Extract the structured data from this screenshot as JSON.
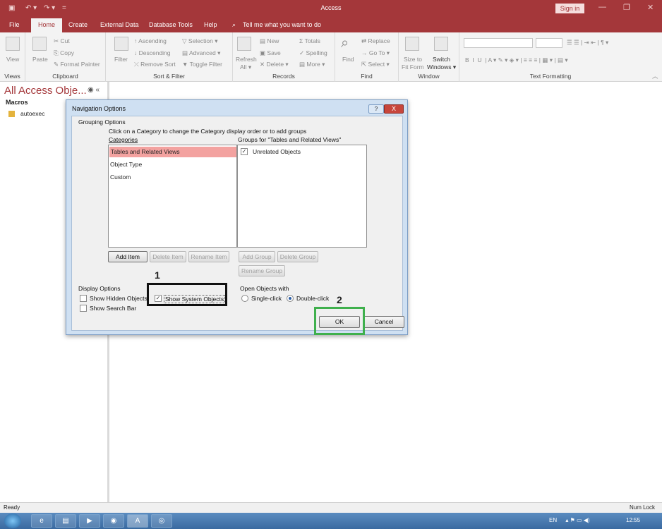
{
  "window": {
    "title": "Access",
    "sign_in": "Sign in"
  },
  "tabs": [
    "File",
    "Home",
    "Create",
    "External Data",
    "Database Tools",
    "Help"
  ],
  "tell_me": "Tell me what you want to do",
  "ribbon": {
    "views": {
      "view": "View",
      "group": "Views"
    },
    "clipboard": {
      "paste": "Paste",
      "cut": "Cut",
      "copy": "Copy",
      "format_painter": "Format Painter",
      "group": "Clipboard"
    },
    "sort_filter": {
      "filter": "Filter",
      "ascending": "Ascending",
      "descending": "Descending",
      "remove_sort": "Remove Sort",
      "selection": "Selection",
      "advanced": "Advanced",
      "toggle_filter": "Toggle Filter",
      "group": "Sort & Filter"
    },
    "records": {
      "refresh": "Refresh",
      "refresh_all": "All",
      "new": "New",
      "save": "Save",
      "delete": "Delete",
      "totals": "Totals",
      "spelling": "Spelling",
      "more": "More",
      "group": "Records"
    },
    "find": {
      "find": "Find",
      "replace": "Replace",
      "goto": "Go To",
      "select": "Select",
      "group": "Find"
    },
    "window": {
      "size_to_fit": "Size to",
      "size_to_fit2": "Fit Form",
      "switch": "Switch",
      "switch2": "Windows",
      "group": "Window"
    },
    "text_formatting": {
      "group": "Text Formatting"
    }
  },
  "nav_pane": {
    "title": "All Access Obje...",
    "section": "Macros",
    "items": [
      "autoexec"
    ]
  },
  "status": {
    "left": "Ready",
    "right": "Num Lock"
  },
  "taskbar": {
    "lang": "EN",
    "clock": "12:55"
  },
  "dialog": {
    "title": "Navigation Options",
    "help": "?",
    "close": "X",
    "grouping_options": "Grouping Options",
    "instruction": "Click on a Category to change the Category display order or to add groups",
    "categories_label": "Categories",
    "groups_label": "Groups for \"Tables and Related Views\"",
    "categories": [
      "Tables and Related Views",
      "Object Type",
      "Custom"
    ],
    "groups": [
      {
        "label": "Unrelated Objects",
        "checked": true
      }
    ],
    "buttons": {
      "add_item": "Add Item",
      "delete_item": "Delete Item",
      "rename_item": "Rename Item",
      "add_group": "Add Group",
      "delete_group": "Delete Group",
      "rename_group": "Rename Group",
      "ok": "OK",
      "cancel": "Cancel"
    },
    "display_options": {
      "label": "Display Options",
      "show_hidden": {
        "label": "Show Hidden Objects",
        "checked": false
      },
      "show_system": {
        "label": "Show System Objects",
        "checked": true
      },
      "show_search": {
        "label": "Show Search Bar",
        "checked": false
      }
    },
    "open_objects": {
      "label": "Open Objects with",
      "single": "Single-click",
      "double": "Double-click",
      "selected": "Double-click"
    }
  },
  "annotations": {
    "one": "1",
    "two": "2"
  }
}
